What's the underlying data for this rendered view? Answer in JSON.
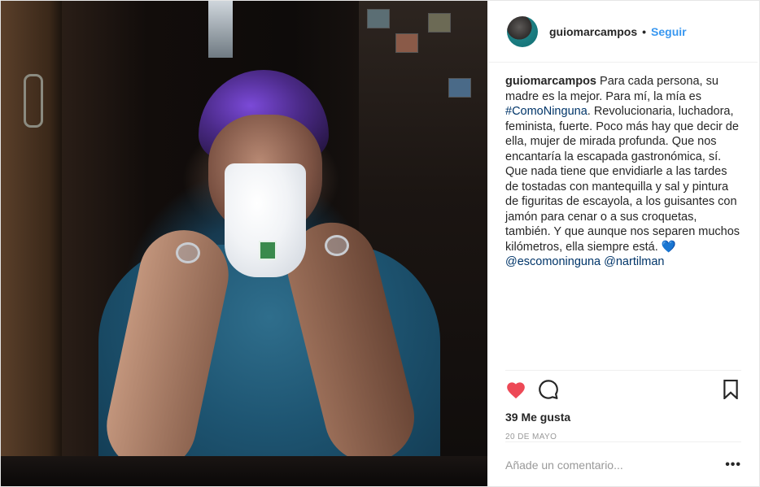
{
  "colors": {
    "accent": "#3897f0",
    "like": "#ed4956",
    "hashtag": "#003569",
    "emoji_heart": "#2b8ae6",
    "muted": "#999999"
  },
  "header": {
    "username": "guiomarcampos",
    "separator": "•",
    "follow_label": "Seguir",
    "avatar_icon": "avatar"
  },
  "caption": {
    "username": "guiomarcampos",
    "text_1": " Para cada persona, su madre es la mejor. Para mí, la mía es ",
    "hashtag": "#ComoNinguna",
    "text_2": ". Revolucionaria, luchadora, feminista, fuerte. Poco más hay que decir de ella, mujer de mirada profunda. Que nos encantaría la escapada gastronómica, sí. Que nada tiene que envidiarle a las tardes de tostadas con mantequilla y sal y pintura de figuritas de escayola, a los guisantes con jamón para cenar o a sus croquetas, también. Y que aunque nos separen muchos kilómetros, ella siempre está. ",
    "emoji": "💙",
    "mention_1": "@escomoninguna",
    "mention_2": "@nartilman"
  },
  "actions": {
    "like_icon": "heart-filled-icon",
    "comment_icon": "comment-icon",
    "save_icon": "bookmark-icon"
  },
  "likes_text": "39 Me gusta",
  "date_text": "20 DE MAYO",
  "comment": {
    "placeholder": "Añade un comentario...",
    "value": "",
    "more_label": "•••"
  }
}
